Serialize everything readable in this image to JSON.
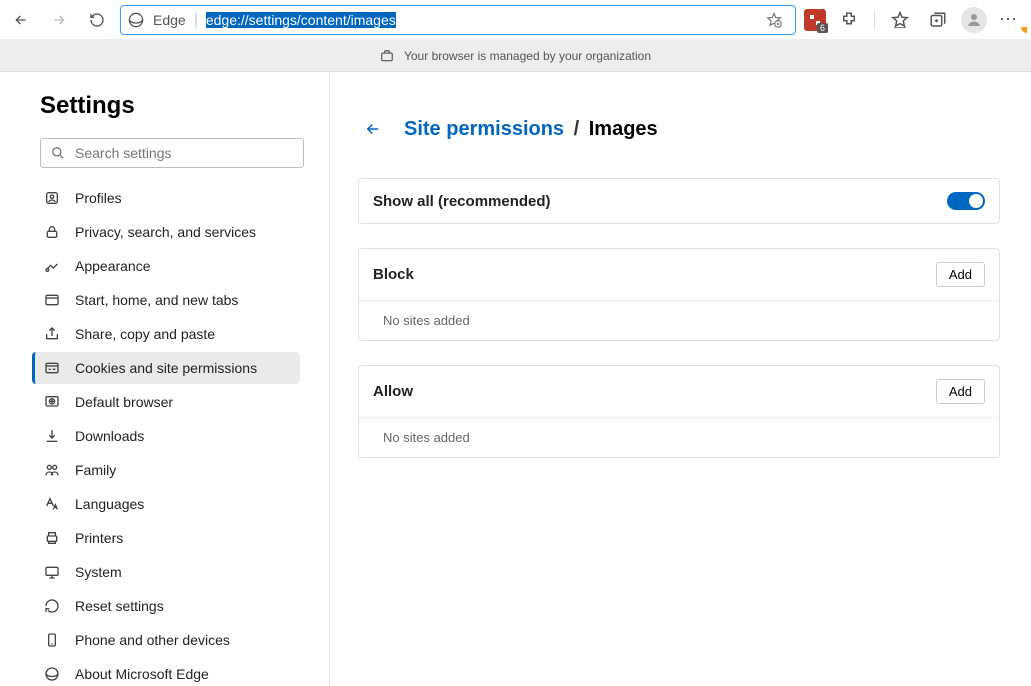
{
  "toolbar": {
    "edge_label": "Edge",
    "url": "edge://settings/content/images",
    "ext_count": "6"
  },
  "managed_text": "Your browser is managed by your organization",
  "sidebar": {
    "title": "Settings",
    "search_placeholder": "Search settings",
    "items": [
      {
        "label": "Profiles",
        "icon": "profile"
      },
      {
        "label": "Privacy, search, and services",
        "icon": "lock"
      },
      {
        "label": "Appearance",
        "icon": "appearance"
      },
      {
        "label": "Start, home, and new tabs",
        "icon": "window"
      },
      {
        "label": "Share, copy and paste",
        "icon": "share"
      },
      {
        "label": "Cookies and site permissions",
        "icon": "cookies",
        "active": true
      },
      {
        "label": "Default browser",
        "icon": "browser"
      },
      {
        "label": "Downloads",
        "icon": "download"
      },
      {
        "label": "Family",
        "icon": "family"
      },
      {
        "label": "Languages",
        "icon": "language"
      },
      {
        "label": "Printers",
        "icon": "printer"
      },
      {
        "label": "System",
        "icon": "system"
      },
      {
        "label": "Reset settings",
        "icon": "reset"
      },
      {
        "label": "Phone and other devices",
        "icon": "phone"
      },
      {
        "label": "About Microsoft Edge",
        "icon": "edge"
      }
    ]
  },
  "breadcrumb": {
    "link": "Site permissions",
    "current": "Images"
  },
  "cards": {
    "show_all": {
      "title": "Show all (recommended)"
    },
    "block": {
      "title": "Block",
      "button": "Add",
      "empty": "No sites added"
    },
    "allow": {
      "title": "Allow",
      "button": "Add",
      "empty": "No sites added"
    }
  }
}
